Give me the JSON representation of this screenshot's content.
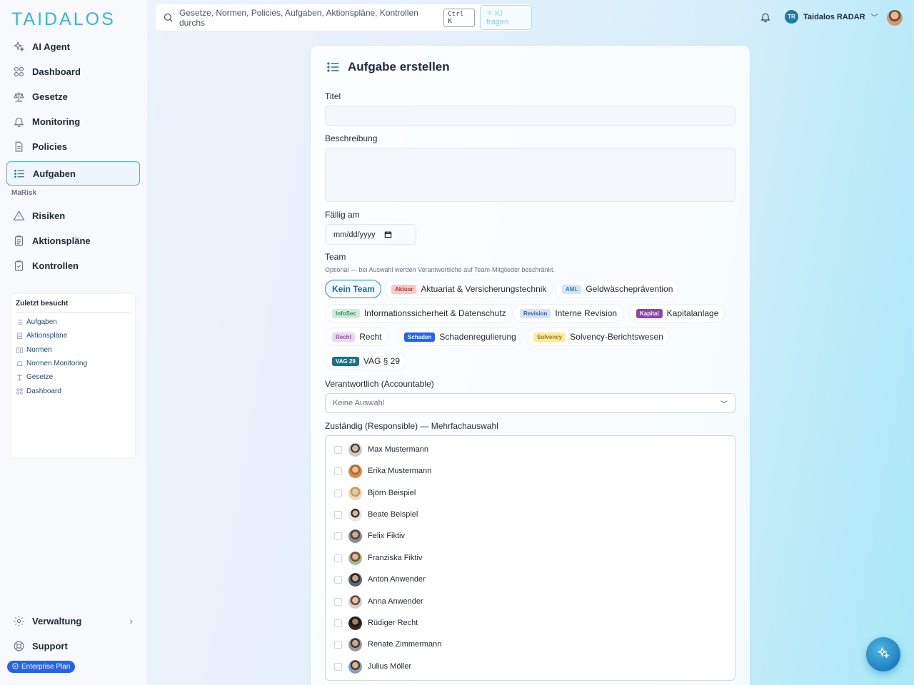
{
  "brand": {
    "logo": "TAIDALOS"
  },
  "nav": {
    "items": [
      {
        "label": "AI Agent",
        "icon": "sparkle-icon"
      },
      {
        "label": "Dashboard",
        "icon": "grid-icon"
      },
      {
        "label": "Gesetze",
        "icon": "scale-icon"
      },
      {
        "label": "Monitoring",
        "icon": "bell-icon"
      },
      {
        "label": "Policies",
        "icon": "document-icon"
      },
      {
        "label": "Aufgaben",
        "icon": "list-icon",
        "active": true
      }
    ],
    "section_label": "MaRisk",
    "section_items": [
      {
        "label": "Risiken",
        "icon": "warning-icon"
      },
      {
        "label": "Aktionspläne",
        "icon": "clipboard-icon"
      },
      {
        "label": "Kontrollen",
        "icon": "clipboard-check-icon"
      }
    ],
    "bottom": [
      {
        "label": "Verwaltung",
        "icon": "gear-icon"
      },
      {
        "label": "Support",
        "icon": "lifebuoy-icon"
      }
    ],
    "plan": "Enterprise Plan"
  },
  "recent": {
    "title": "Zuletzt besucht",
    "items": [
      "Aufgaben",
      "Aktionspläne",
      "Normen",
      "Normen Monitoring",
      "Gesetze",
      "Dashboard"
    ]
  },
  "topbar": {
    "search_placeholder": "Gesetze, Normen, Policies, Aufgaben, Aktionspläne, Kontrollen durchs",
    "shortcut": "Ctrl K",
    "ki_button": "KI fragen",
    "user_initials": "TR",
    "user_name": "Taidalos RADAR"
  },
  "form": {
    "title": "Aufgabe erstellen",
    "title_label": "Titel",
    "description_label": "Beschreibung",
    "due_label": "Fällig am",
    "due_placeholder": "mm/dd/yyyy",
    "team_label": "Team",
    "team_hint": "Optional — bei Auswahl werden Verantwortliche auf Team-Mitglieder beschränkt.",
    "teams": [
      {
        "badge": "",
        "name": "Kein Team",
        "selected": true
      },
      {
        "badge": "Aktuar",
        "name": "Aktuariat & Versicherungstechnik",
        "badge_bg": "#f9c9c9",
        "badge_fg": "#c0392b"
      },
      {
        "badge": "AML",
        "name": "Geldwäscheprävention",
        "badge_bg": "#cfe8f5",
        "badge_fg": "#3a7fa8"
      },
      {
        "badge": "InfoSec",
        "name": "Informationssicherheit & Datenschutz",
        "badge_bg": "#cdeedb",
        "badge_fg": "#2f8f5a"
      },
      {
        "badge": "Revision",
        "name": "Interne Revision",
        "badge_bg": "#d6e3f7",
        "badge_fg": "#3b5f9e"
      },
      {
        "badge": "Kapital",
        "name": "Kapitalanlage",
        "badge_bg": "#8e44ad",
        "badge_fg": "#ffffff"
      },
      {
        "badge": "Recht",
        "name": "Recht",
        "badge_bg": "#ead8f5",
        "badge_fg": "#8e5aa8"
      },
      {
        "badge": "Schaden",
        "name": "Schadenregulierung",
        "badge_bg": "#2563eb",
        "badge_fg": "#ffffff"
      },
      {
        "badge": "Solvency",
        "name": "Solvency-Berichtswesen",
        "badge_bg": "#fbeaa0",
        "badge_fg": "#9a7a10"
      },
      {
        "badge": "VAG 29",
        "name": "VAG § 29",
        "badge_bg": "#1e6f8a",
        "badge_fg": "#ffffff"
      }
    ],
    "accountable_label": "Verantwortlich (Accountable)",
    "accountable_value": "Keine Auswahl",
    "responsible_label": "Zuständig (Responsible) — Mehrfachauswahl",
    "people": [
      "Max Mustermann",
      "Erika Mustermann",
      "Björn Beispiel",
      "Beate Beispiel",
      "Felix Fiktiv",
      "Franziska Fiktiv",
      "Anton Anwender",
      "Anna Anwender",
      "Rüdiger Recht",
      "Renate Zimmermann",
      "Julius Möller"
    ]
  }
}
